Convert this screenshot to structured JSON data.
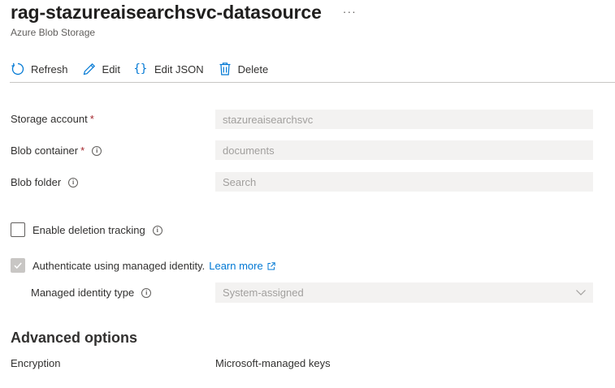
{
  "header": {
    "title": "rag-stazureaisearchsvc-datasource",
    "more": "···",
    "subtitle": "Azure Blob Storage"
  },
  "toolbar": {
    "refresh": {
      "label": "Refresh",
      "icon": "refresh-icon"
    },
    "edit": {
      "label": "Edit",
      "icon": "pencil-icon"
    },
    "edit_json": {
      "label": "Edit JSON",
      "icon": "braces-icon",
      "glyph": "{}"
    },
    "delete": {
      "label": "Delete",
      "icon": "trash-icon"
    }
  },
  "fields": {
    "storage_account": {
      "label": "Storage account",
      "required": "*",
      "value": "stazureaisearchsvc"
    },
    "blob_container": {
      "label": "Blob container",
      "required": "*",
      "value": "documents"
    },
    "blob_folder": {
      "label": "Blob folder",
      "placeholder": "Search"
    }
  },
  "deletion_tracking": {
    "label": "Enable deletion tracking",
    "checked": false
  },
  "managed_identity": {
    "label": "Authenticate using managed identity.",
    "link": "Learn more",
    "checked": true,
    "type_label": "Managed identity type",
    "type_value": "System-assigned"
  },
  "advanced": {
    "title": "Advanced options",
    "encryption_label": "Encryption",
    "encryption_value": "Microsoft-managed keys"
  },
  "colors": {
    "accent": "#0078d4",
    "required": "#a4262c",
    "disabled_bg": "#f3f2f1",
    "disabled_text": "#a19f9d"
  }
}
